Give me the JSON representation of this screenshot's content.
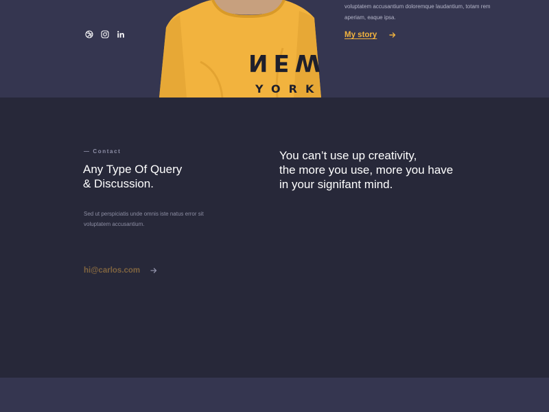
{
  "hero": {
    "about_text": "voluptatem accusantium doloremque laudantium, totam rem aperiam, eaque ipsa.",
    "story_link_label": "My story",
    "social_icons": [
      "dribbble-icon",
      "instagram-icon",
      "linkedin-icon"
    ],
    "photo_shirt_text_line1": "NEW",
    "photo_shirt_text_line2": "YORK"
  },
  "contact": {
    "eyebrow": "— Contact",
    "title": "Any Type Of Query\n& Discussion.",
    "description": "Sed ut perspiciatis unde omnis iste natus error sit voluptatem accusantium.",
    "email": "hi@carlos.com",
    "quote": "You can’t use up creativity,\nthe more you use, more you have\nin your signifant mind."
  },
  "colors": {
    "hero_bg": "#353650",
    "contact_bg": "#272839",
    "accent": "#f2b33e",
    "email_accent": "#7f6440"
  }
}
